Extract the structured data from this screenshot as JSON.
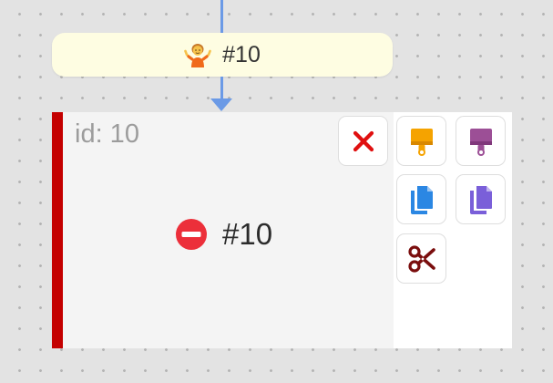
{
  "connector": {
    "color": "#6b9ae6"
  },
  "comment_label": {
    "icon": "person-shrugging-icon",
    "text": "#10",
    "background": "#fefde2"
  },
  "node": {
    "id_label": "id: 10",
    "content_icon": "no-entry-icon",
    "content_text": "#10",
    "accent_color": "#c40000",
    "toolbar": [
      {
        "name": "delete-button",
        "icon": "cross-icon",
        "color": "#e01010"
      },
      {
        "name": "paint-orange-button",
        "icon": "paint-brush-icon",
        "color": "#f5a300"
      },
      {
        "name": "paint-purple-button",
        "icon": "paint-brush-icon",
        "color": "#9c4f96"
      },
      {
        "name": "copy-blue-button",
        "icon": "copy-icon",
        "color": "#2b87e3"
      },
      {
        "name": "copy-purple-button",
        "icon": "copy-icon",
        "color": "#7a5fd9"
      },
      {
        "name": "cut-button",
        "icon": "scissors-icon",
        "color": "#7a0d0d"
      }
    ]
  }
}
